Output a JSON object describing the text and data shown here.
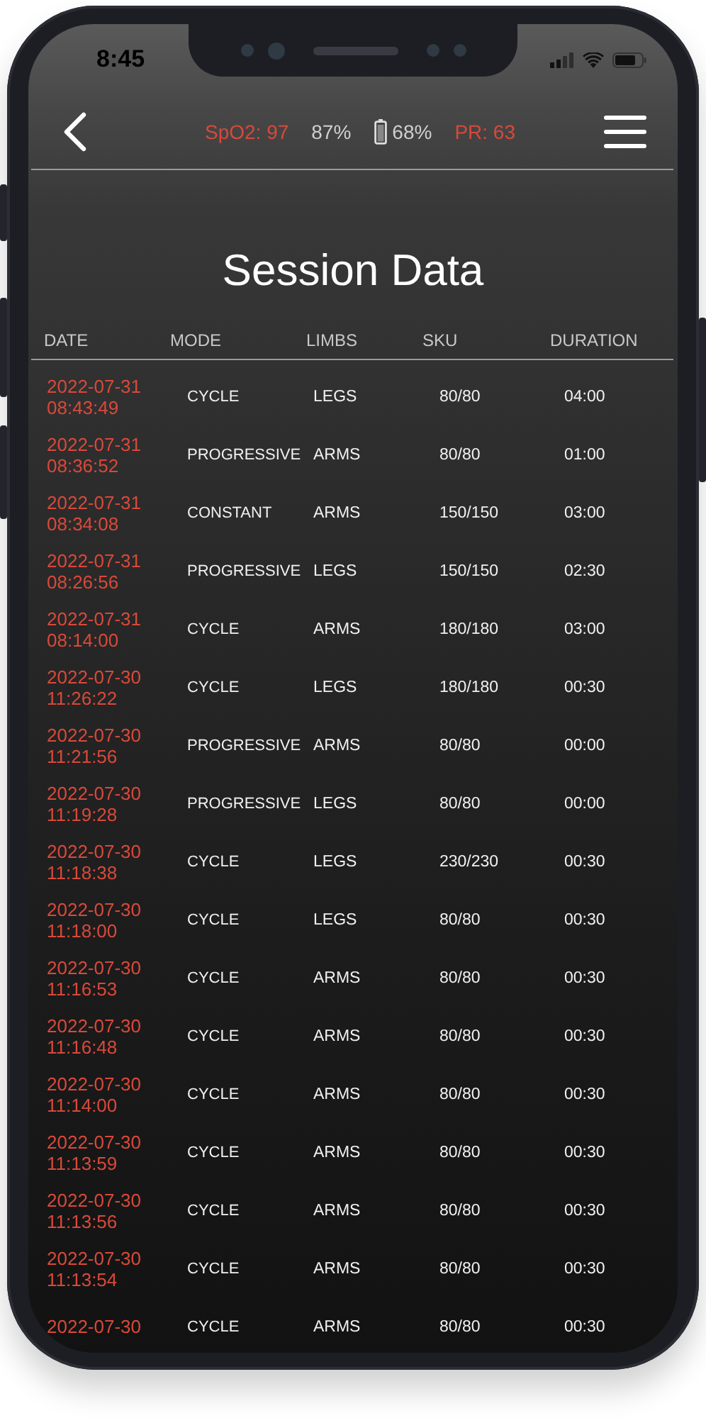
{
  "status_bar": {
    "time": "8:45"
  },
  "header": {
    "stats": [
      {
        "kind": "vital",
        "text": "SpO2: 97"
      },
      {
        "kind": "plain",
        "text": "87%"
      },
      {
        "kind": "battery",
        "text": "68%"
      },
      {
        "kind": "vital",
        "text": "PR: 63"
      }
    ]
  },
  "title": "Session Data",
  "table": {
    "columns": [
      "DATE",
      "MODE",
      "LIMBS",
      "SKU",
      "DURATION"
    ],
    "rows": [
      {
        "date": "2022-07-31",
        "time": "08:43:49",
        "mode": "CYCLE",
        "limbs": "LEGS",
        "sku": "80/80",
        "duration": "04:00"
      },
      {
        "date": "2022-07-31",
        "time": "08:36:52",
        "mode": "PROGRESSIVE",
        "limbs": "ARMS",
        "sku": "80/80",
        "duration": "01:00"
      },
      {
        "date": "2022-07-31",
        "time": "08:34:08",
        "mode": "CONSTANT",
        "limbs": "ARMS",
        "sku": "150/150",
        "duration": "03:00"
      },
      {
        "date": "2022-07-31",
        "time": "08:26:56",
        "mode": "PROGRESSIVE",
        "limbs": "LEGS",
        "sku": "150/150",
        "duration": "02:30"
      },
      {
        "date": "2022-07-31",
        "time": "08:14:00",
        "mode": "CYCLE",
        "limbs": "ARMS",
        "sku": "180/180",
        "duration": "03:00"
      },
      {
        "date": "2022-07-30",
        "time": "11:26:22",
        "mode": "CYCLE",
        "limbs": "LEGS",
        "sku": "180/180",
        "duration": "00:30"
      },
      {
        "date": "2022-07-30",
        "time": "11:21:56",
        "mode": "PROGRESSIVE",
        "limbs": "ARMS",
        "sku": "80/80",
        "duration": "00:00"
      },
      {
        "date": "2022-07-30",
        "time": "11:19:28",
        "mode": "PROGRESSIVE",
        "limbs": "LEGS",
        "sku": "80/80",
        "duration": "00:00"
      },
      {
        "date": "2022-07-30",
        "time": "11:18:38",
        "mode": "CYCLE",
        "limbs": "LEGS",
        "sku": "230/230",
        "duration": "00:30"
      },
      {
        "date": "2022-07-30",
        "time": "11:18:00",
        "mode": "CYCLE",
        "limbs": "LEGS",
        "sku": "80/80",
        "duration": "00:30"
      },
      {
        "date": "2022-07-30",
        "time": "11:16:53",
        "mode": "CYCLE",
        "limbs": "ARMS",
        "sku": "80/80",
        "duration": "00:30"
      },
      {
        "date": "2022-07-30",
        "time": "11:16:48",
        "mode": "CYCLE",
        "limbs": "ARMS",
        "sku": "80/80",
        "duration": "00:30"
      },
      {
        "date": "2022-07-30",
        "time": "11:14:00",
        "mode": "CYCLE",
        "limbs": "ARMS",
        "sku": "80/80",
        "duration": "00:30"
      },
      {
        "date": "2022-07-30",
        "time": "11:13:59",
        "mode": "CYCLE",
        "limbs": "ARMS",
        "sku": "80/80",
        "duration": "00:30"
      },
      {
        "date": "2022-07-30",
        "time": "11:13:56",
        "mode": "CYCLE",
        "limbs": "ARMS",
        "sku": "80/80",
        "duration": "00:30"
      },
      {
        "date": "2022-07-30",
        "time": "11:13:54",
        "mode": "CYCLE",
        "limbs": "ARMS",
        "sku": "80/80",
        "duration": "00:30"
      },
      {
        "date": "2022-07-30",
        "mode": "CYCLE",
        "limbs": "ARMS",
        "sku": "80/80",
        "duration": "00:30"
      }
    ]
  }
}
